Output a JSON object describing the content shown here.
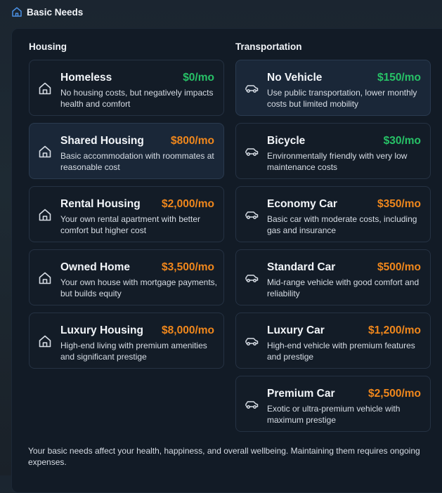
{
  "header": {
    "title": "Basic Needs",
    "icon": "home-icon"
  },
  "housing": {
    "title": "Housing",
    "items": [
      {
        "name": "Homeless",
        "price": "$0/mo",
        "price_color": "green",
        "desc": "No housing costs, but negatively impacts health and comfort"
      },
      {
        "name": "Shared Housing",
        "price": "$800/mo",
        "price_color": "orange",
        "desc": "Basic accommodation with roommates at reasonable cost",
        "selected": true
      },
      {
        "name": "Rental Housing",
        "price": "$2,000/mo",
        "price_color": "orange",
        "desc": "Your own rental apartment with better comfort but higher cost"
      },
      {
        "name": "Owned Home",
        "price": "$3,500/mo",
        "price_color": "orange",
        "desc": "Your own house with mortgage payments, but builds equity"
      },
      {
        "name": "Luxury Housing",
        "price": "$8,000/mo",
        "price_color": "orange",
        "desc": "High-end living with premium amenities and significant prestige"
      }
    ]
  },
  "transportation": {
    "title": "Transportation",
    "items": [
      {
        "name": "No Vehicle",
        "price": "$150/mo",
        "price_color": "green",
        "desc": "Use public transportation, lower monthly costs but limited mobility",
        "selected": true
      },
      {
        "name": "Bicycle",
        "price": "$30/mo",
        "price_color": "green",
        "desc": "Environmentally friendly with very low maintenance costs"
      },
      {
        "name": "Economy Car",
        "price": "$350/mo",
        "price_color": "orange",
        "desc": "Basic car with moderate costs, including gas and insurance"
      },
      {
        "name": "Standard Car",
        "price": "$500/mo",
        "price_color": "orange",
        "desc": "Mid-range vehicle with good comfort and reliability"
      },
      {
        "name": "Luxury Car",
        "price": "$1,200/mo",
        "price_color": "orange",
        "desc": "High-end vehicle with premium features and prestige"
      },
      {
        "name": "Premium Car",
        "price": "$2,500/mo",
        "price_color": "orange",
        "desc": "Exotic or ultra-premium vehicle with maximum prestige"
      }
    ]
  },
  "footer": {
    "text": "Your basic needs affect your health, happiness, and overall wellbeing. Maintaining them requires ongoing expenses."
  },
  "colors": {
    "green": "#27c267",
    "orange": "#f0871c",
    "accent": "#4a90e2"
  }
}
